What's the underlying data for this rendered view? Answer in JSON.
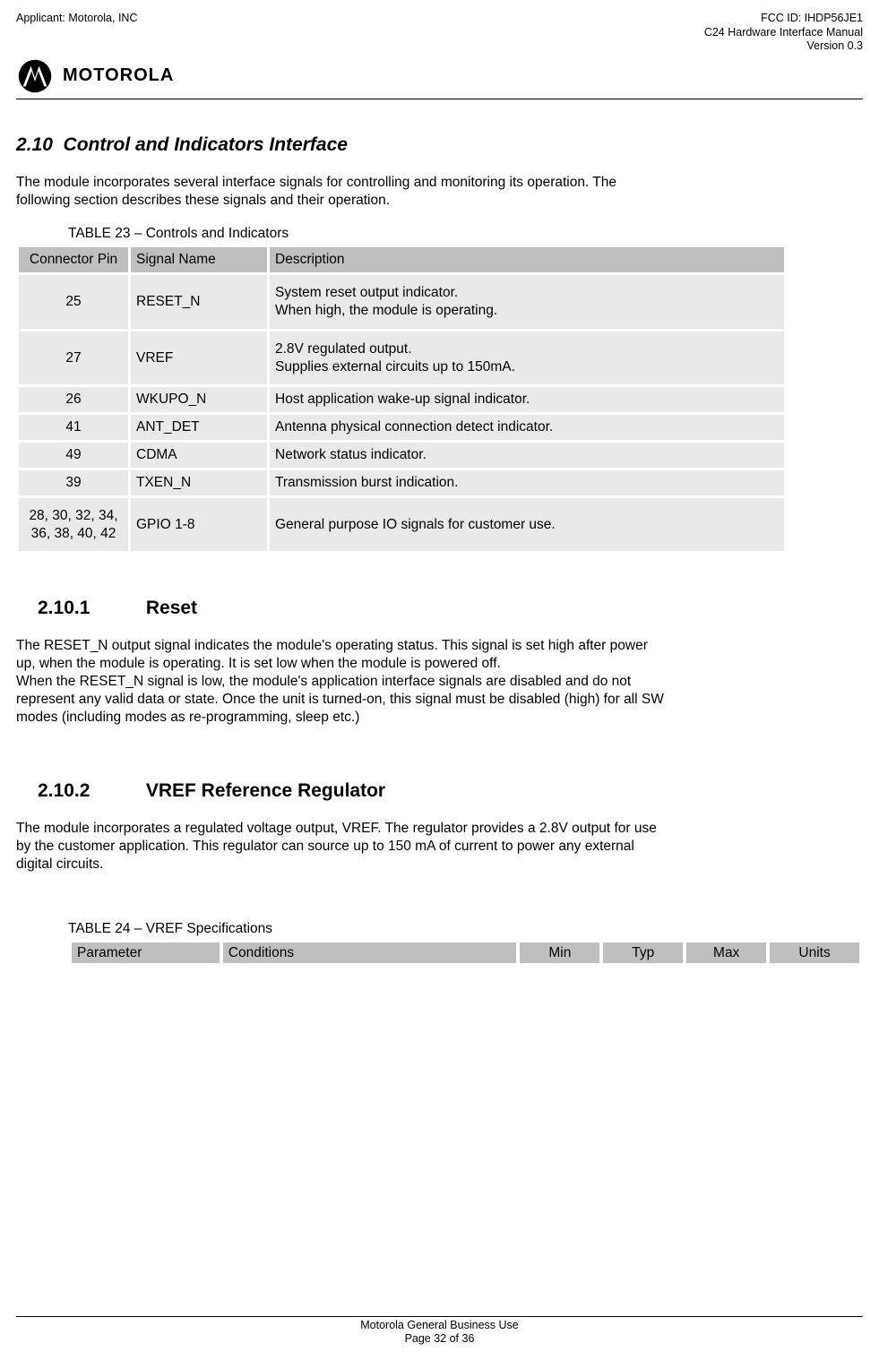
{
  "header": {
    "applicant": "Applicant: Motorola, INC",
    "fcc": "FCC ID: IHDP56JE1",
    "manual": "C24 Hardware Interface Manual",
    "version": "Version 0.3",
    "wordmark": "MOTOROLA"
  },
  "sec": {
    "num": "2.10",
    "title": "Control and Indicators Interface",
    "intro_l1": "The module incorporates several interface signals for controlling and monitoring its operation. The",
    "intro_l2": "following section describes these signals and their operation."
  },
  "table23": {
    "caption": "TABLE 23 – Controls and Indicators",
    "head": {
      "c0": "Connector Pin",
      "c1": "Signal Name",
      "c2": "Description"
    },
    "rows": [
      {
        "pin": "25",
        "name": "RESET_N",
        "desc": "System reset output indicator.\nWhen high, the module is operating."
      },
      {
        "pin": "27",
        "name": "VREF",
        "desc": "2.8V regulated output.\nSupplies external circuits up to 150mA."
      },
      {
        "pin": "26",
        "name": "WKUPO_N",
        "desc": "Host application wake-up signal indicator."
      },
      {
        "pin": "41",
        "name": "ANT_DET",
        "desc": "Antenna physical connection detect indicator."
      },
      {
        "pin": "49",
        "name": "CDMA",
        "desc": "Network status indicator."
      },
      {
        "pin": "39",
        "name": "TXEN_N",
        "desc": "Transmission burst indication."
      },
      {
        "pin": "28, 30, 32, 34, 36, 38, 40, 42",
        "name": "GPIO 1-8",
        "desc": "General purpose IO signals for customer use."
      }
    ]
  },
  "sub_reset": {
    "num": "2.10.1",
    "title": "Reset",
    "p1": "The RESET_N output signal indicates the module's operating status. This signal is set high after power",
    "p2": "up, when the module is operating. It is set low when the module is powered off.",
    "p3": "When the RESET_N signal is low, the module's application interface signals are disabled and do not",
    "p4": "represent any valid data or state. Once the unit is turned-on, this signal must be disabled (high) for all SW",
    "p5": "modes (including modes as re-programming, sleep etc.)"
  },
  "sub_vref": {
    "num": "2.10.2",
    "title": "VREF Reference Regulator",
    "p1": "The module incorporates a regulated voltage output, VREF. The regulator provides a 2.8V output for use",
    "p2": "by the customer application. This regulator can source up to 150 mA of current to power any external",
    "p3": "digital circuits."
  },
  "table24": {
    "caption": "TABLE 24 – VREF Specifications",
    "head": {
      "param": "Parameter",
      "cond": "Conditions",
      "min": "Min",
      "typ": "Typ",
      "max": "Max",
      "units": "Units"
    }
  },
  "footer": {
    "l1": "Motorola General Business Use",
    "l2": "Page 32 of 36"
  }
}
